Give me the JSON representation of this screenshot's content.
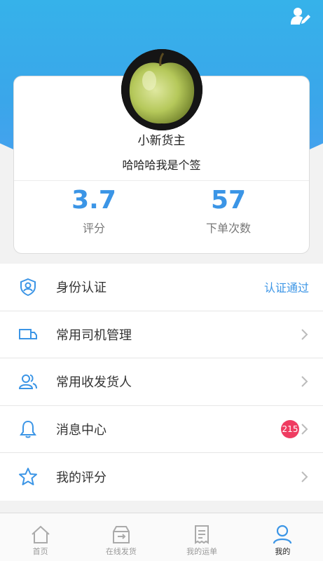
{
  "header": {
    "edit_icon": "user-edit-icon",
    "colors": {
      "accent": "#3b95e6",
      "gradient_top": "#36b2ea",
      "gradient_bottom": "#4a9ff0"
    }
  },
  "profile": {
    "avatar": "green-apple-photo",
    "name": "小新货主",
    "signature": "哈哈哈我是个签",
    "stats": [
      {
        "value": "3.7",
        "label": "评分"
      },
      {
        "value": "57",
        "label": "下单次数"
      }
    ]
  },
  "menu": [
    {
      "label": "身份认证",
      "icon": "shield-user-icon",
      "status": "认证通过"
    },
    {
      "label": "常用司机管理",
      "icon": "truck-icon"
    },
    {
      "label": "常用收发货人",
      "icon": "contacts-icon"
    },
    {
      "label": "消息中心",
      "icon": "bell-icon",
      "badge": "215"
    },
    {
      "label": "我的评分",
      "icon": "star-icon"
    }
  ],
  "tabbar": [
    {
      "label": "首页",
      "icon": "home-icon"
    },
    {
      "label": "在线发货",
      "icon": "cargo-icon"
    },
    {
      "label": "我的运单",
      "icon": "receipt-icon"
    },
    {
      "label": "我的",
      "icon": "person-icon",
      "active": true
    }
  ]
}
